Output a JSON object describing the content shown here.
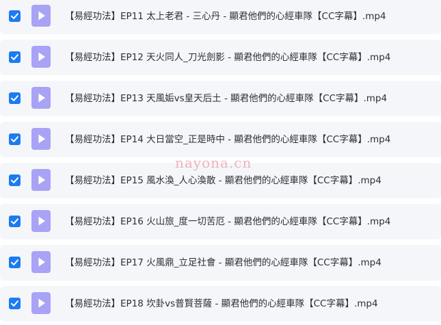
{
  "files": [
    {
      "name": "【易經功法】EP11 太上老君 - 三心丹  - 顯君他們的心經車隊【CC字幕】.mp4",
      "checked": true,
      "icon": "video-file-icon"
    },
    {
      "name": "【易經功法】EP12 天火同人_刀光劍影  - 顯君他們的心經車隊【CC字幕】.mp4",
      "checked": true,
      "icon": "video-file-icon"
    },
    {
      "name": "【易經功法】EP13 天風姤vs皇天后土 - 顯君他們的心經車隊【CC字幕】.mp4",
      "checked": true,
      "icon": "video-file-icon"
    },
    {
      "name": "【易經功法】EP14 大日當空_正是時中 - 顯君他們的心經車隊【CC字幕】.mp4",
      "checked": true,
      "icon": "video-file-icon"
    },
    {
      "name": "【易經功法】EP15 風水渙_人心渙散 - 顯君他們的心經車隊【CC字幕】.mp4",
      "checked": true,
      "icon": "video-file-icon"
    },
    {
      "name": "【易經功法】EP16 火山旅_度一切苦厄 - 顯君他們的心經車隊【CC字幕】.mp4",
      "checked": true,
      "icon": "video-file-icon"
    },
    {
      "name": "【易經功法】EP17 火風鼎_立足社會 - 顯君他們的心經車隊【CC字幕】.mp4",
      "checked": true,
      "icon": "video-file-icon"
    },
    {
      "name": "【易經功法】EP18 坎卦vs普賢菩薩 - 顯君他們的心經車隊【CC字幕】.mp4",
      "checked": true,
      "icon": "video-file-icon"
    }
  ],
  "watermark": "nayona.cn",
  "colors": {
    "row_background": "#f5f6fa",
    "checkbox": "#1d7bf0",
    "video_icon": "#a8a3f5",
    "text": "#2d2f38",
    "watermark": "#f1b2b8"
  }
}
